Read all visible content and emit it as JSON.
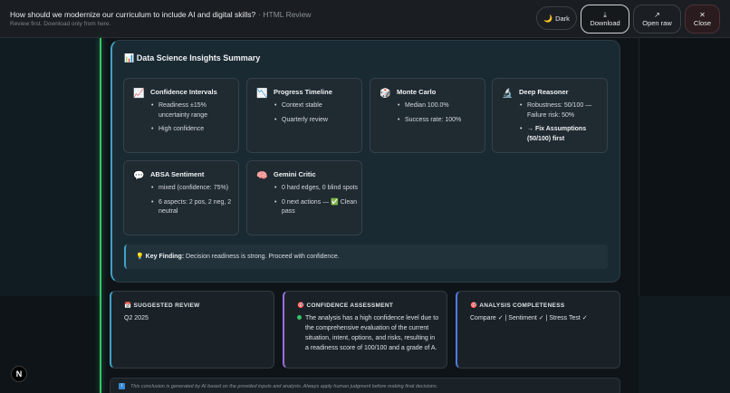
{
  "topbar": {
    "title": "How should we modernize our curriculum to include AI and digital skills?",
    "subtitle": "· HTML Review",
    "hint": "Review first. Download only from here.",
    "dark_label": "Dark",
    "download_label": "Download",
    "open_raw_label": "Open raw",
    "close_label": "Close"
  },
  "summary": {
    "title": "Data Science Insights Summary",
    "tiles": [
      {
        "icon": "📈",
        "title": "Confidence Intervals",
        "items": [
          "Readiness ±15% uncertainty range",
          "High confidence"
        ]
      },
      {
        "icon": "📉",
        "title": "Progress Timeline",
        "items": [
          "Context stable",
          "Quarterly review"
        ]
      },
      {
        "icon": "🎲",
        "title": "Monte Carlo",
        "items": [
          "Median 100.0%",
          "Success rate: 100%"
        ]
      },
      {
        "icon": "🔬",
        "title": "Deep Reasoner",
        "items": [
          "Robustness: 50/100 — Failure risk: 50%",
          "→ Fix Assumptions (50/100) first"
        ]
      },
      {
        "icon": "💬",
        "title": "ABSA Sentiment",
        "items": [
          "mixed (confidence: 75%)",
          "6 aspects: 2 pos, 2 neg, 2 neutral"
        ]
      },
      {
        "icon": "🧠",
        "title": "Gemini Critic",
        "items": [
          "0 hard edges, 0 blind spots",
          "0 next actions — ✅ Clean pass"
        ]
      }
    ],
    "key_finding_label": "Key Finding:",
    "key_finding_text": "Decision readiness is strong. Proceed with confidence."
  },
  "cards": {
    "review_title": "SUGGESTED REVIEW",
    "review_value": "Q2 2025",
    "confidence_title": "CONFIDENCE ASSESSMENT",
    "confidence_text": "The analysis has a high confidence level due to the comprehensive evaluation of the current situation, intent, options, and risks, resulting in a readiness score of 100/100 and a grade of A.",
    "completeness_title": "ANALYSIS COMPLETENESS",
    "completeness_text": "Compare ✓ | Sentiment ✓ | Stress Test ✓"
  },
  "disclaimer": "This conclusion is generated by AI based on the provided inputs and analysis. Always apply human judgment before making final decisions.",
  "badge": "N",
  "colors": {
    "accent": "#3da2c8",
    "green": "#34c46a",
    "purple": "#9b6fe0",
    "blue": "#4f7ae0"
  }
}
